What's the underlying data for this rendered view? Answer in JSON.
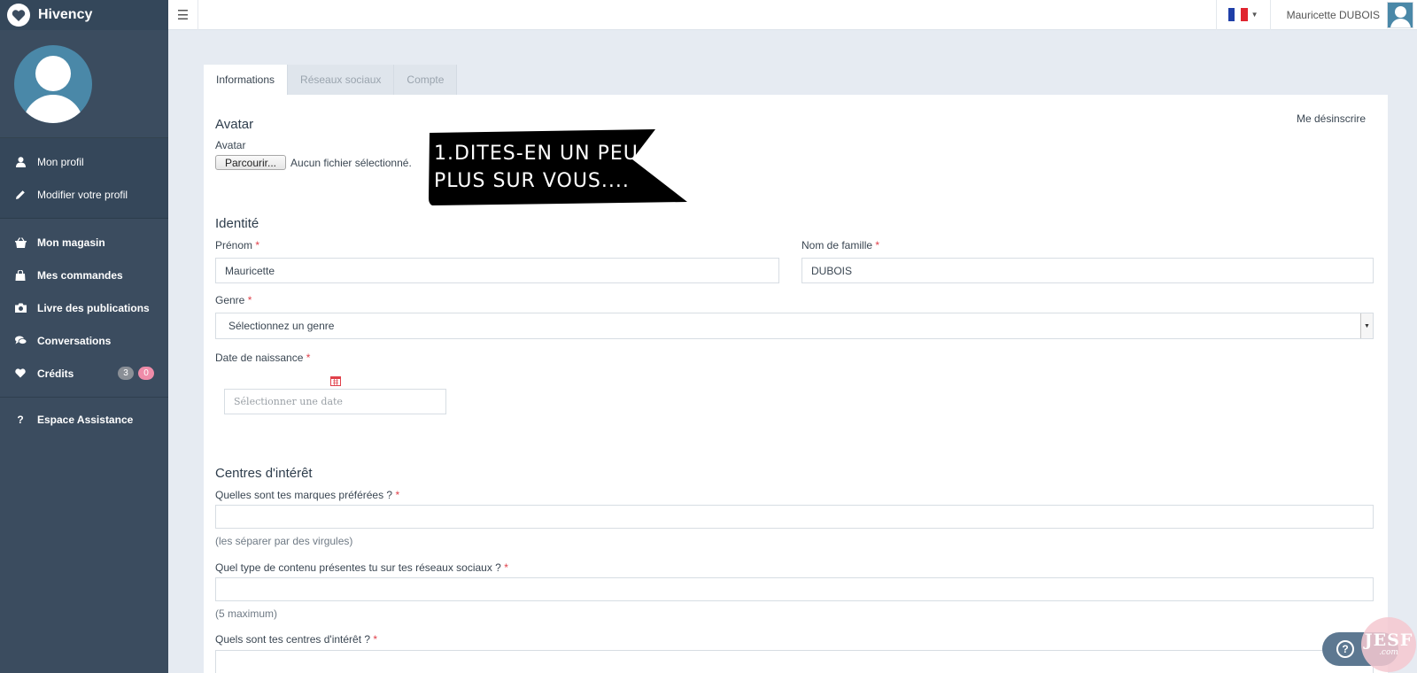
{
  "brand": {
    "name": "Hivency",
    "logo_icon": "heart-icon"
  },
  "sidebar": {
    "profile_items": [
      {
        "label": "Mon profil",
        "icon": "user-icon"
      },
      {
        "label": "Modifier votre profil",
        "icon": "pencil-icon"
      }
    ],
    "main_items": [
      {
        "label": "Mon magasin",
        "icon": "basket-icon"
      },
      {
        "label": "Mes commandes",
        "icon": "shopping-bag-icon"
      },
      {
        "label": "Livre des publications",
        "icon": "camera-icon"
      },
      {
        "label": "Conversations",
        "icon": "comments-icon"
      },
      {
        "label": "Crédits",
        "icon": "heart-icon",
        "badge_gray": "3",
        "badge_pink": "0"
      }
    ],
    "help_item": {
      "label": "Espace Assistance",
      "icon": "question-icon"
    },
    "colors": {
      "background": "#3b4c5f",
      "badge_pink": "#ef8ca9"
    }
  },
  "topbar": {
    "menu_icon": "hamburger-icon",
    "language_icon": "french-flag-icon",
    "user_name": "Mauricette DUBOIS"
  },
  "tabs": [
    {
      "label": "Informations",
      "active": true
    },
    {
      "label": "Réseaux sociaux",
      "active": false
    },
    {
      "label": "Compte",
      "active": false
    }
  ],
  "form": {
    "unsubscribe_link": "Me désinscrire",
    "avatar": {
      "section_title": "Avatar",
      "field_label": "Avatar",
      "browse_button": "Parcourir...",
      "file_status": "Aucun fichier sélectionné."
    },
    "banner_text": "1.Dites-en un peu plus sur vous....",
    "identity": {
      "section_title": "Identité",
      "first_name_label": "Prénom",
      "first_name_value": "Mauricette",
      "last_name_label": "Nom de famille",
      "last_name_value": "DUBOIS",
      "gender_label": "Genre",
      "gender_value": "Sélectionnez un genre",
      "birthdate_label": "Date de naissance",
      "birthdate_placeholder": "Sélectionner une date",
      "calendar_icon": "calendar-icon",
      "required_mark": "*"
    },
    "interests": {
      "section_title": "Centres d'intérêt",
      "brands_label": "Quelles sont tes marques préférées ?",
      "brands_hint": "(les séparer par des virgules)",
      "content_label": "Quel type de contenu présentes tu sur tes réseaux sociaux ?",
      "content_hint": "(5 maximum)",
      "interests_label": "Quels sont tes centres d'intérêt ?",
      "required_mark": "*"
    }
  },
  "help_button": {
    "label": "?"
  },
  "watermark": {
    "line1": "JESF",
    "line2": ".com"
  }
}
